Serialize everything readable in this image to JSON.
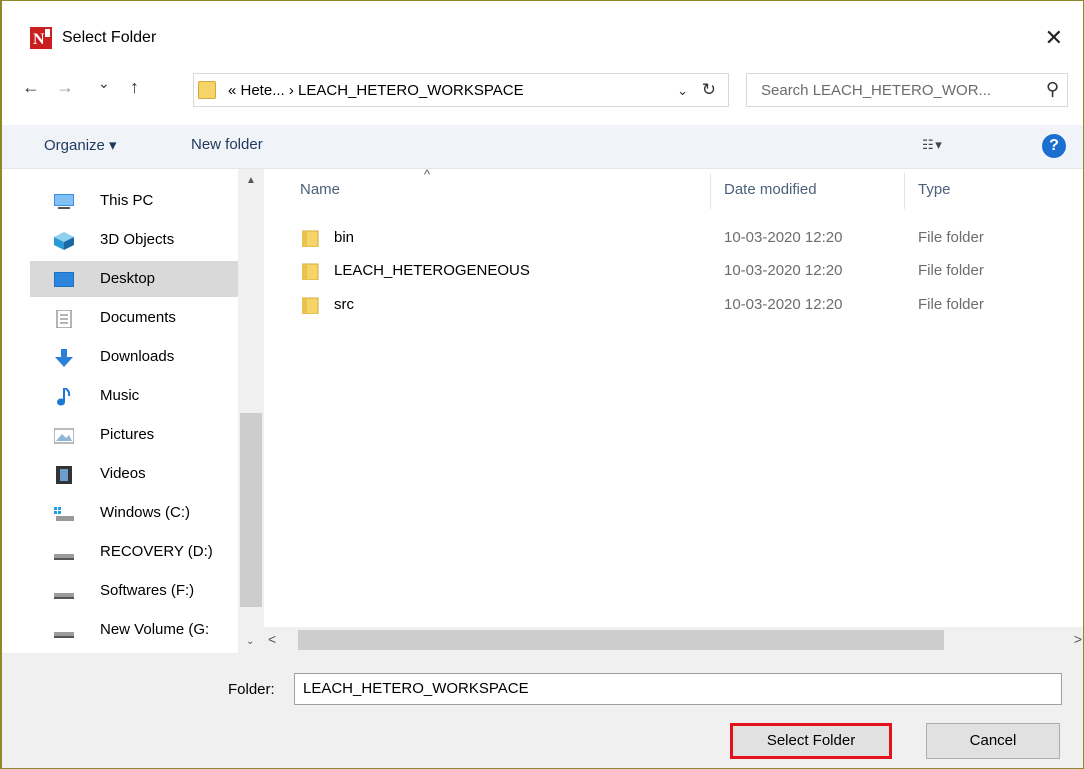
{
  "window": {
    "title": "Select Folder",
    "close_glyph": "✕",
    "app_icon": "app-logo-icon"
  },
  "nav": {
    "back_glyph": "←",
    "forward_glyph": "→",
    "recent_glyph": "⌄",
    "up_glyph": "↑",
    "address_path": "« Hete... ›  LEACH_HETERO_WORKSPACE",
    "address_dropdown_glyph": "⌄",
    "refresh_glyph": "↻",
    "search_placeholder": "Search LEACH_HETERO_WOR...",
    "search_glyph": "⚲"
  },
  "toolbar": {
    "organize_label": "Organize ▾",
    "new_folder_label": "New folder",
    "view_glyph": "☷ ▾",
    "help_glyph": "?"
  },
  "sidebar": {
    "items": [
      {
        "label": "This PC",
        "icon": "computer-icon"
      },
      {
        "label": "3D Objects",
        "icon": "cube-icon"
      },
      {
        "label": "Desktop",
        "icon": "desktop-icon",
        "selected": true
      },
      {
        "label": "Documents",
        "icon": "document-icon"
      },
      {
        "label": "Downloads",
        "icon": "download-icon"
      },
      {
        "label": "Music",
        "icon": "music-note-icon"
      },
      {
        "label": "Pictures",
        "icon": "picture-icon"
      },
      {
        "label": "Videos",
        "icon": "film-icon"
      },
      {
        "label": "Windows (C:)",
        "icon": "windows-drive-icon"
      },
      {
        "label": "RECOVERY (D:)",
        "icon": "drive-icon"
      },
      {
        "label": "Softwares (F:)",
        "icon": "drive-icon"
      },
      {
        "label": "New Volume (G:",
        "icon": "drive-icon"
      }
    ],
    "scroll_up_glyph": "▲",
    "scroll_down_glyph": "⌄"
  },
  "file_list": {
    "sort_glyph": "^",
    "columns": {
      "name": "Name",
      "date": "Date modified",
      "type": "Type"
    },
    "rows": [
      {
        "name": "bin",
        "date": "10-03-2020 12:20",
        "type": "File folder"
      },
      {
        "name": "LEACH_HETEROGENEOUS",
        "date": "10-03-2020 12:20",
        "type": "File folder"
      },
      {
        "name": "src",
        "date": "10-03-2020 12:20",
        "type": "File folder"
      }
    ],
    "hscroll_left_glyph": "<",
    "hscroll_right_glyph": ">"
  },
  "footer": {
    "folder_label": "Folder:",
    "folder_value": "LEACH_HETERO_WORKSPACE",
    "select_button": "Select Folder",
    "cancel_button": "Cancel"
  },
  "colors": {
    "folder_yellow": "#f5d56a",
    "highlight_red": "#e3121b",
    "help_blue": "#1a6fd0",
    "selected_bg": "#d9d9d9"
  }
}
